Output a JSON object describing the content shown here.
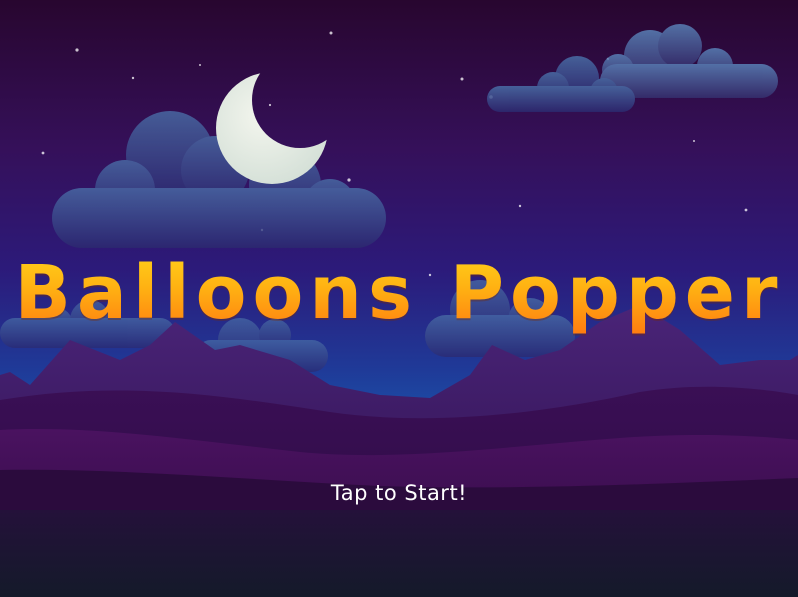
{
  "game": {
    "title": "Balloons Popper",
    "start_prompt": "Tap to Start!"
  },
  "scene": {
    "time_of_day": "night",
    "moon_phase": "crescent",
    "sky_colors": [
      "#2a0838",
      "#35106a",
      "#1f2a8a",
      "#1b4fa8"
    ],
    "hill_colors": [
      "#3a1660",
      "#2e0f4a",
      "#3c0f4e",
      "#2a0a3a"
    ],
    "ground_color": "#151a2e",
    "title_gradient": [
      "#ffd21a",
      "#ffb012",
      "#ff7a10"
    ]
  }
}
